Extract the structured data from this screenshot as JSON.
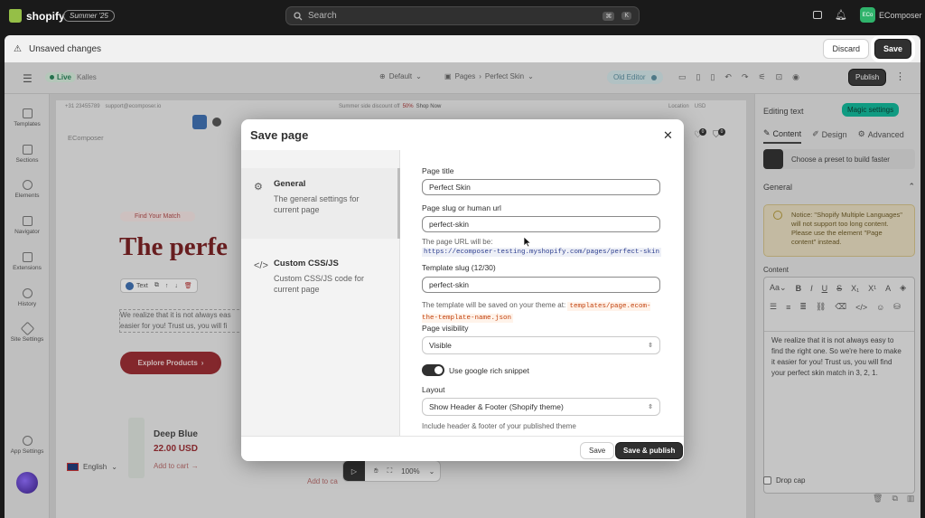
{
  "topbar": {
    "brand": "shopify",
    "edition_badge": "Summer '25",
    "search_placeholder": "Search",
    "shortcut_key1": "⌘",
    "shortcut_key2": "K",
    "store_initials": "ECo",
    "store_name": "EComposer"
  },
  "unsaved_bar": {
    "message": "Unsaved changes",
    "discard_label": "Discard",
    "save_label": "Save"
  },
  "editor_toolbar": {
    "live_badge": "Live",
    "theme_name": "Kalles",
    "template_select": "Default",
    "breadcrumb_root": "Pages",
    "breadcrumb_page": "Perfect Skin",
    "old_editor_label": "Old Editor",
    "publish_label": "Publish"
  },
  "left_sidebar": {
    "items": [
      "Templates",
      "Sections",
      "Elements",
      "Navigator",
      "Extensions",
      "History",
      "Site Settings"
    ],
    "app_settings": "App Settings"
  },
  "canvas": {
    "phone": "+31 23455789",
    "email": "support@ecomposer.io",
    "promo_prefix": "Summer side discount off",
    "promo_pct": "50%",
    "promo_link": "Shop Now",
    "location_label": "Location",
    "currency": "USD",
    "site_name": "EComposer",
    "cart_count": "0",
    "wishlist_count": "0",
    "eyebrow": "Find Your Match",
    "headline": "The perfe",
    "text_toolbar_label": "Text",
    "body_text": "We realize that it is not always eas easier for you! Trust us, you will fi",
    "cta": "Explore Products",
    "product_name": "Deep Blue",
    "product_price": "22.00 USD",
    "add_to_cart": "Add to cart",
    "add_to_cart_2": "Add to ca",
    "language": "English",
    "zoom": "100%"
  },
  "right_panel": {
    "title": "Editing text",
    "magic_settings": "Magic settings",
    "tabs": [
      "Content",
      "Design",
      "Advanced"
    ],
    "preset_hint": "Choose a preset to build faster",
    "section_general": "General",
    "notice": "Notice: \"Shopify Multiple Languages\" will not support too long content. Please use the element \"Page content\" instead.",
    "content_label": "Content",
    "editor_text": "We realize that it is not always easy to find the right one. So we're here to make it easier for you! Trust us, you will find your perfect skin match in 3, 2, 1.",
    "drop_cap": "Drop cap"
  },
  "modal": {
    "title": "Save page",
    "nav": [
      {
        "title": "General",
        "desc": "The general settings for current page"
      },
      {
        "title": "Custom CSS/JS",
        "desc": "Custom CSS/JS code for current page"
      }
    ],
    "page_title_label": "Page title",
    "page_title_value": "Perfect Skin",
    "slug_label": "Page slug or human url",
    "slug_value": "perfect-skin",
    "url_help": "The page URL will be:",
    "url_value": "https://ecomposer-testing.myshopify.com/pages/perfect-skin",
    "template_slug_label": "Template slug (12/30)",
    "template_slug_value": "perfect-skin",
    "template_help": "The template will be saved on your theme at:",
    "template_path": "templates/page.ecom-the-template-name.json",
    "visibility_label": "Page visibility",
    "visibility_value": "Visible",
    "rich_snippet_label": "Use google rich snippet",
    "layout_label": "Layout",
    "layout_value": "Show Header & Footer (Shopify theme)",
    "layout_help": "Include header & footer of your published theme",
    "save_label": "Save",
    "save_publish_label": "Save & publish"
  },
  "colors": {
    "topbar_bg": "#1a1a1a",
    "primary_button": "#303030",
    "headline": "#7a1f22",
    "cta": "#9b2b31",
    "magic_button": "#0fb99a"
  }
}
